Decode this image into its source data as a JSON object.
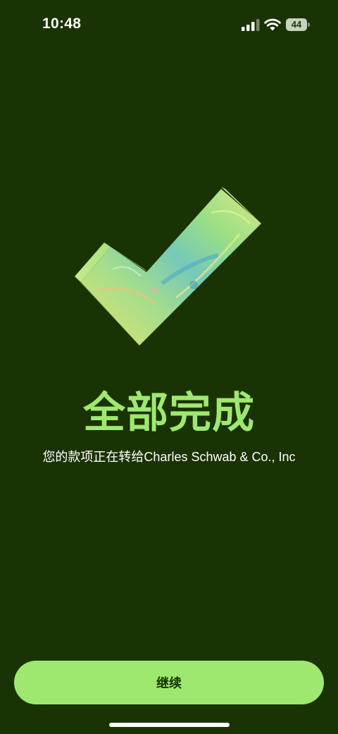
{
  "status_bar": {
    "time": "10:48",
    "battery_level": "44",
    "icons": [
      "signal-icon",
      "wifi-icon",
      "battery-icon"
    ]
  },
  "illustration": {
    "icon": "checkmark-icon",
    "colors": [
      "#f3e36a",
      "#8fdc7f",
      "#5cb8c8",
      "#c8a07a"
    ]
  },
  "main": {
    "title": "全部完成",
    "subtitle": "您的款项正在转给Charles Schwab & Co., Inc"
  },
  "footer": {
    "continue_label": "继续"
  },
  "colors": {
    "background": "#1a3305",
    "accent": "#9fe870",
    "button_text": "#163300"
  }
}
